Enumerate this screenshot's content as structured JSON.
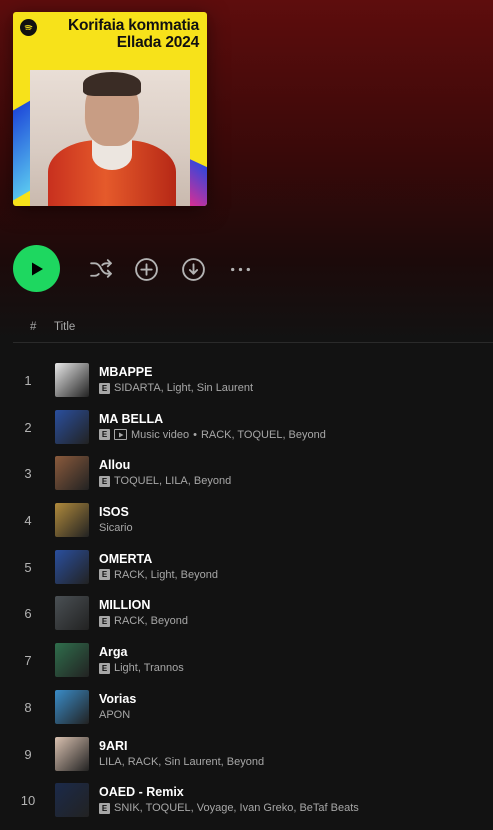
{
  "playlist": {
    "cover_title_line1": "Korifaia kommatia",
    "cover_title_line2": "Ellada 2024",
    "cover_bg": "#f7e21a"
  },
  "controls": {
    "play_icon": "play-icon",
    "shuffle_icon": "shuffle-icon",
    "add_icon": "add-circle-icon",
    "download_icon": "download-icon",
    "more_icon": "more-options-icon",
    "accent": "#1ed760"
  },
  "table": {
    "col_num": "#",
    "col_title": "Title"
  },
  "tracks": [
    {
      "num": "1",
      "title": "MBAPPE",
      "explicit": "E",
      "video": false,
      "video_label": "",
      "artists": "SIDARTA, Light, Sin Laurent",
      "art_color": "#e8e8e8"
    },
    {
      "num": "2",
      "title": "MA BELLA",
      "explicit": "E",
      "video": true,
      "video_label": "Music video",
      "artists": "RACK, TOQUEL, Beyond",
      "art_color": "#2a4f9e"
    },
    {
      "num": "3",
      "title": "Allou",
      "explicit": "E",
      "video": false,
      "video_label": "",
      "artists": "TOQUEL, LILA, Beyond",
      "art_color": "#8a5a3c"
    },
    {
      "num": "4",
      "title": "ISOS",
      "explicit": "",
      "video": false,
      "video_label": "",
      "artists": "Sicario",
      "art_color": "#b08a3c"
    },
    {
      "num": "5",
      "title": "OMERTA",
      "explicit": "E",
      "video": false,
      "video_label": "",
      "artists": "RACK, Light, Beyond",
      "art_color": "#2a4f9e"
    },
    {
      "num": "6",
      "title": "MILLION",
      "explicit": "E",
      "video": false,
      "video_label": "",
      "artists": "RACK, Beyond",
      "art_color": "#4a5054"
    },
    {
      "num": "7",
      "title": "Arga",
      "explicit": "E",
      "video": false,
      "video_label": "",
      "artists": "Light, Trannos",
      "art_color": "#2f6e4c"
    },
    {
      "num": "8",
      "title": "Vorias",
      "explicit": "",
      "video": false,
      "video_label": "",
      "artists": "APON",
      "art_color": "#3a8cc8"
    },
    {
      "num": "9",
      "title": "9ARI",
      "explicit": "",
      "video": false,
      "video_label": "",
      "artists": "LILA, RACK, Sin Laurent, Beyond",
      "art_color": "#d9c1b0"
    },
    {
      "num": "10",
      "title": "OAED - Remix",
      "explicit": "E",
      "video": false,
      "video_label": "",
      "artists": "SNIK, TOQUEL, Voyage, Ivan Greko, BeTaf Beats",
      "art_color": "#1b2a4a"
    }
  ]
}
